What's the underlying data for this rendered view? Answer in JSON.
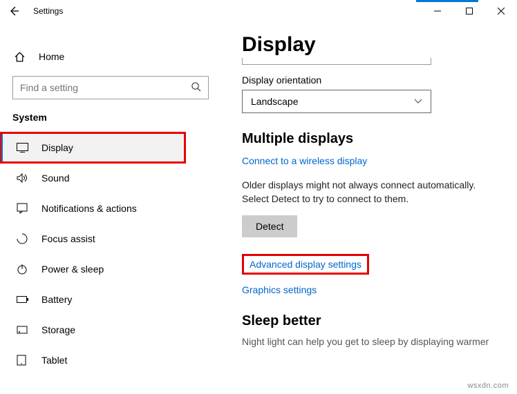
{
  "titlebar": {
    "title": "Settings"
  },
  "sidebar": {
    "home_label": "Home",
    "search_placeholder": "Find a setting",
    "section_label": "System",
    "items": [
      {
        "label": "Display"
      },
      {
        "label": "Sound"
      },
      {
        "label": "Notifications & actions"
      },
      {
        "label": "Focus assist"
      },
      {
        "label": "Power & sleep"
      },
      {
        "label": "Battery"
      },
      {
        "label": "Storage"
      },
      {
        "label": "Tablet"
      }
    ]
  },
  "content": {
    "page_title": "Display",
    "orientation_label": "Display orientation",
    "orientation_value": "Landscape",
    "multiple_heading": "Multiple displays",
    "wireless_link": "Connect to a wireless display",
    "detect_desc": "Older displays might not always connect automatically. Select Detect to try to connect to them.",
    "detect_btn": "Detect",
    "advanced_link": "Advanced display settings",
    "graphics_link": "Graphics settings",
    "sleep_heading": "Sleep better",
    "sleep_desc": "Night light can help you get to sleep by displaying warmer"
  },
  "watermark": "wsxdn.com"
}
